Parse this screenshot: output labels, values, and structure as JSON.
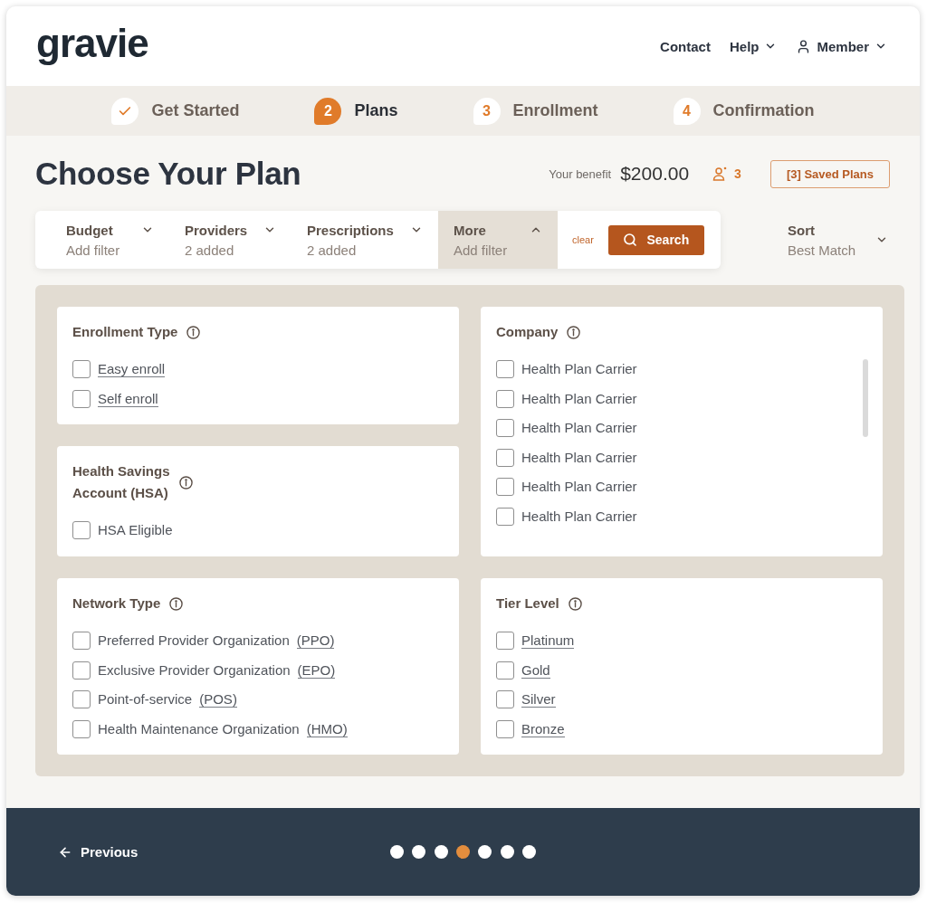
{
  "header": {
    "logo": "gravie",
    "nav": [
      {
        "kind": "link",
        "label": "Contact"
      },
      {
        "kind": "dropdown",
        "label": "Help"
      },
      {
        "kind": "account",
        "label": "Member"
      }
    ]
  },
  "steps": [
    {
      "label": "Get Started",
      "completed": true,
      "current": false
    },
    {
      "number": "2",
      "label": "Plans",
      "completed": false,
      "current": true
    },
    {
      "number": "3",
      "label": "Enrollment",
      "completed": false,
      "current": false
    },
    {
      "number": "4",
      "label": "Confirmation",
      "completed": false,
      "current": false
    }
  ],
  "page_header": {
    "title": "Choose Your Plan",
    "benefit_label": "Your benefit",
    "benefit_amount": "$200.00",
    "member_count": "3",
    "saved_plans_button": "[3] Saved Plans"
  },
  "filter_bar": {
    "filters": [
      {
        "label": "Budget",
        "value": "Add filter",
        "expanded": false
      },
      {
        "label": "Providers",
        "value": "2 added",
        "expanded": false
      },
      {
        "label": "Prescriptions",
        "value": "2 added",
        "expanded": false
      },
      {
        "label": "More",
        "value": "Add filter",
        "expanded": true
      }
    ],
    "clear_link": "clear",
    "search_button": "Search"
  },
  "sort": {
    "label": "Sort",
    "value": "Best Match"
  },
  "filter_panel": {
    "groups": [
      {
        "title": "Enrollment Type",
        "options": [
          {
            "label": "Easy enroll",
            "linked": true,
            "checked": false
          },
          {
            "label": "Self enroll",
            "linked": true,
            "checked": false
          }
        ]
      },
      {
        "title": "Company",
        "scrollable": true,
        "options": [
          {
            "label": "Health Plan Carrier",
            "linked": false,
            "checked": false
          },
          {
            "label": "Health Plan Carrier",
            "linked": false,
            "checked": false
          },
          {
            "label": "Health Plan Carrier",
            "linked": false,
            "checked": false
          },
          {
            "label": "Health Plan Carrier",
            "linked": false,
            "checked": false
          },
          {
            "label": "Health Plan Carrier",
            "linked": false,
            "checked": false
          },
          {
            "label": "Health Plan Carrier",
            "linked": false,
            "checked": false
          }
        ]
      },
      {
        "title": "Health Savings\nAccount (HSA)",
        "options": [
          {
            "label": "HSA Eligible",
            "linked": false,
            "checked": false
          }
        ]
      },
      {
        "title": "Network Type",
        "options": [
          {
            "label": "Preferred Provider Organization",
            "abbreviation": "(PPO)",
            "linked": false,
            "checked": false
          },
          {
            "label": "Exclusive Provider Organization",
            "abbreviation": "(EPO)",
            "linked": false,
            "checked": false
          },
          {
            "label": "Point-of-service",
            "abbreviation": "(POS)",
            "linked": false,
            "checked": false
          },
          {
            "label": "Health Maintenance Organization",
            "abbreviation": "(HMO)",
            "linked": false,
            "checked": false
          }
        ]
      },
      {
        "title": "Tier Level",
        "options": [
          {
            "label": "Platinum",
            "linked": true,
            "checked": false
          },
          {
            "label": "Gold",
            "linked": true,
            "checked": false
          },
          {
            "label": "Silver",
            "linked": true,
            "checked": false
          },
          {
            "label": "Bronze",
            "linked": true,
            "checked": false
          }
        ]
      }
    ]
  },
  "footer": {
    "previous_button": "Previous",
    "pages": [
      {
        "selected": false
      },
      {
        "selected": false
      },
      {
        "selected": false
      },
      {
        "selected": true
      },
      {
        "selected": false
      },
      {
        "selected": false
      },
      {
        "selected": false
      }
    ]
  }
}
